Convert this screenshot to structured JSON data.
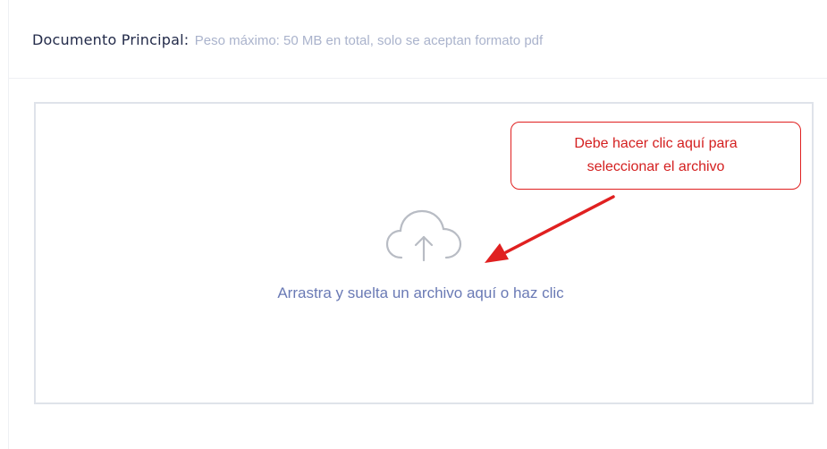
{
  "header": {
    "title": "Documento Principal:",
    "hint": "Peso máximo: 50 MB en total, solo se aceptan formato pdf"
  },
  "dropzone": {
    "icon": "cloud-upload-icon",
    "text": "Arrastra y suelta un archivo aquí o haz clic"
  },
  "annotation": {
    "line1": "Debe hacer clic aquí para",
    "line2": "seleccionar el archivo",
    "color": "#e02020"
  },
  "colors": {
    "title": "#232b4a",
    "hint": "#aab3cc",
    "drop_text": "#6a7ab5",
    "dropzone_border": "#dfe3ea"
  }
}
